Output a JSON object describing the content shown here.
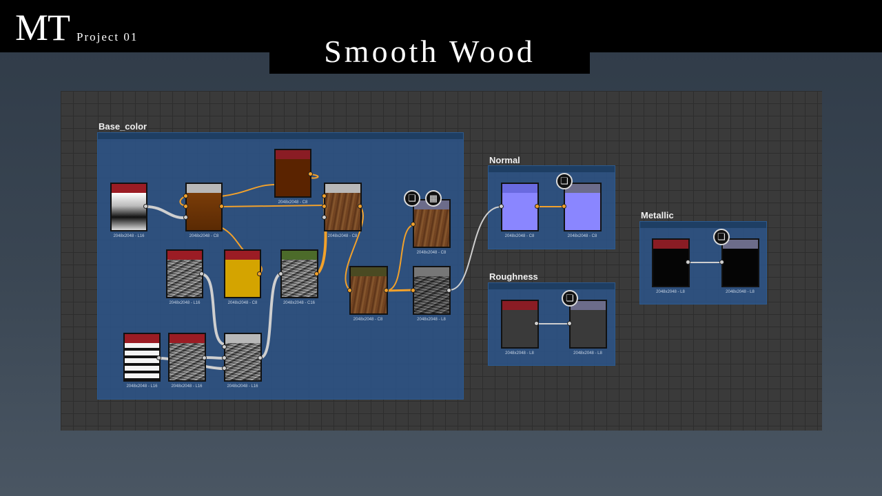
{
  "header": {
    "logo": "MT",
    "project": "Project 01",
    "title": "Smooth Wood"
  },
  "frames": {
    "base_color": "Base_color",
    "normal": "Normal",
    "roughness": "Roughness",
    "metallic": "Metallic"
  },
  "captions": {
    "l16": "2048x2048 - L16",
    "c8": "2048x2048 - C8",
    "c16": "2048x2048 - C16",
    "l8": "2048x2048 - L8"
  },
  "colors": {
    "frame_bg": "#2c568c",
    "canvas_bg": "#3a3a3a",
    "orange_wire": "#f2a12b",
    "gray_wire": "#cfcfcf",
    "head_red": "#9b1c24",
    "head_gray": "#b8b8b8",
    "head_green": "#4c6b2a",
    "head_olive": "#4a4a22",
    "head_violet": "#6c6c8a"
  },
  "icons": [
    "cube-icon",
    "checker-icon"
  ]
}
